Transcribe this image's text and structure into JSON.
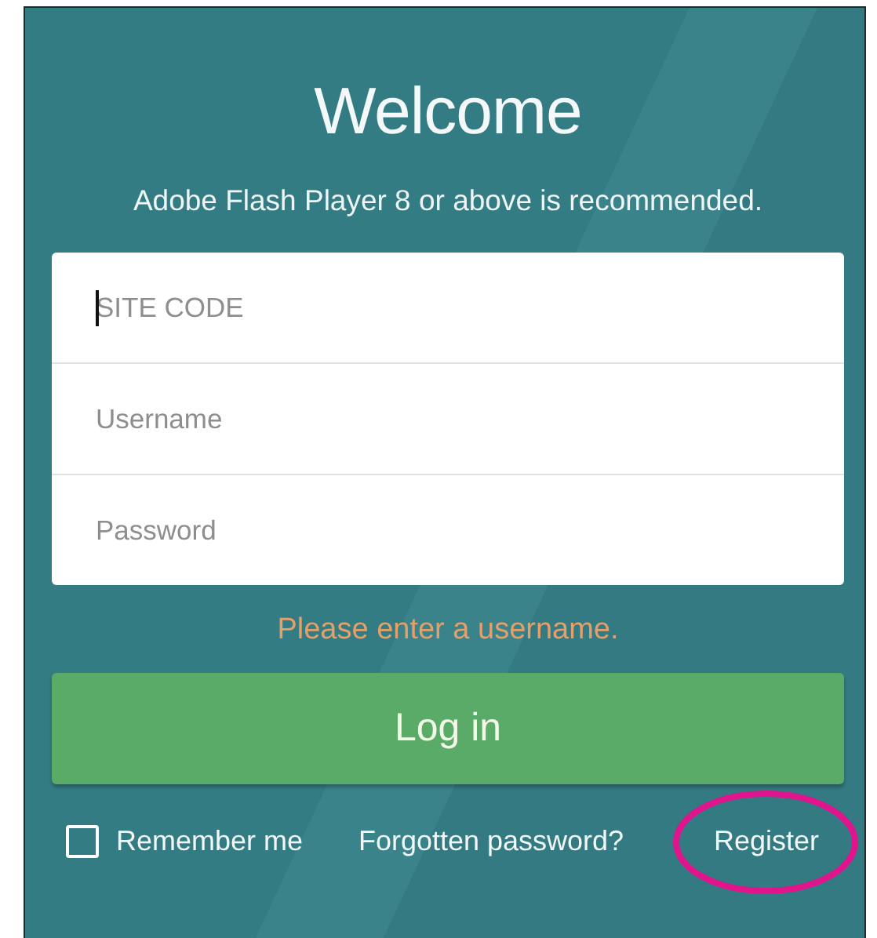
{
  "title": "Welcome",
  "notice": "Adobe Flash Player 8 or above is recommended.",
  "fields": [
    {
      "placeholder": "SITE CODE",
      "focused": true
    },
    {
      "placeholder": "Username",
      "focused": false
    },
    {
      "placeholder": "Password",
      "focused": false
    }
  ],
  "error": "Please enter a username.",
  "login_button": "Log in",
  "remember_me": {
    "label": "Remember me",
    "checked": false
  },
  "links": [
    {
      "label": "Forgotten password?",
      "highlighted": false
    },
    {
      "label": "Register",
      "highlighted": true
    }
  ]
}
